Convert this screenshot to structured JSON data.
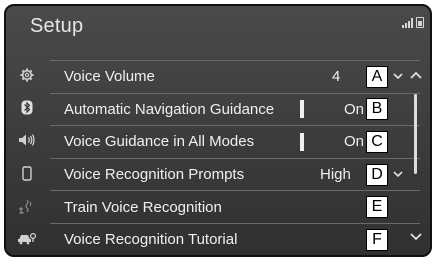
{
  "header": {
    "title": "Setup"
  },
  "sidebar": {
    "icons": [
      "gear-icon",
      "bluetooth-icon",
      "speaker-icon",
      "phone-icon",
      "voice-icon",
      "car-icon"
    ],
    "active": "voice-icon"
  },
  "settings": [
    {
      "label": "Voice Volume",
      "value": "4",
      "callout": "A",
      "control": "dropdown"
    },
    {
      "label": "Automatic Navigation Guidance",
      "value": "On",
      "callout": "B",
      "control": "toggle"
    },
    {
      "label": "Voice Guidance in All Modes",
      "value": "On",
      "callout": "C",
      "control": "toggle"
    },
    {
      "label": "Voice Recognition Prompts",
      "value": "High",
      "callout": "D",
      "control": "dropdown"
    },
    {
      "label": "Train Voice Recognition",
      "value": "",
      "callout": "E",
      "control": "action"
    },
    {
      "label": "Voice Recognition Tutorial",
      "value": "",
      "callout": "F",
      "control": "action"
    }
  ],
  "colors": {
    "background": "#3a3a3a",
    "text": "#f0f0f0",
    "divider": "#6a6a6a",
    "callout_bg": "#ffffff"
  }
}
